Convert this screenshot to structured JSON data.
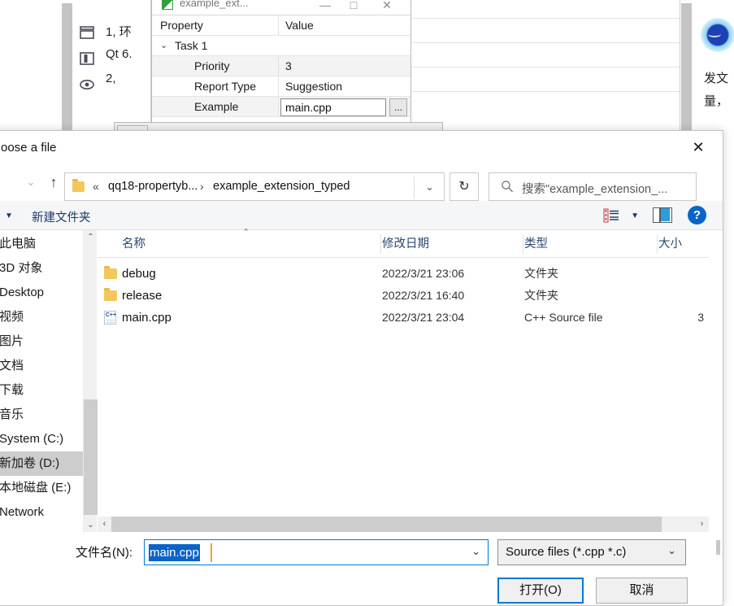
{
  "background_app": {
    "toolbar_icons": [
      "panel-top-icon",
      "panel-split-icon",
      "eye-icon"
    ],
    "code_lines": [
      "1, 环",
      "Qt 6.",
      "2,"
    ],
    "inner_window": {
      "title": "example_ext...",
      "app_icon": "app-icon",
      "minimize_label": "—",
      "maximize_label": "□",
      "close_label": "✕",
      "columns": [
        "Property",
        "Value"
      ],
      "group": {
        "label": "Task 1",
        "chevron": "⌄"
      },
      "rows": [
        {
          "property": "Priority",
          "value": "3"
        },
        {
          "property": "Report Type",
          "value": "Suggestion"
        },
        {
          "property": "Example",
          "value": "main.cpp",
          "browse_label": "..."
        }
      ]
    },
    "right_panel": {
      "avatar": "qq-avatar-icon",
      "lines": [
        "发文",
        "量，"
      ]
    }
  },
  "dialog": {
    "title": "oose a file",
    "close_label": "✕",
    "nav": {
      "back_label": "→",
      "forward_label": "⌄",
      "recent_label": "⌄",
      "up_label": "↑",
      "refresh_label": "↻"
    },
    "breadcrumb": {
      "folder_icon": "folder-icon",
      "leading_sep": "«",
      "parent": "qq18-propertyb...",
      "sep": "›",
      "current": "example_extension_typed",
      "chevron": "⌄"
    },
    "search": {
      "icon": "search-icon",
      "placeholder": "搜索\"example_extension_..."
    },
    "toolbar": {
      "caret": "▼",
      "new_folder_label": "新建文件夹",
      "view_icon": "view-list-icon",
      "view_caret": "▼",
      "preview_pane_icon": "preview-pane-icon",
      "help_label": "?"
    },
    "sidebar": {
      "items": [
        {
          "label": "此电脑",
          "icon": "this-pc-icon",
          "selected": false
        },
        {
          "label": "3D 对象",
          "icon": "3d-objects-icon",
          "selected": false
        },
        {
          "label": "Desktop",
          "icon": "desktop-icon",
          "selected": false
        },
        {
          "label": "视频",
          "icon": "videos-icon",
          "selected": false
        },
        {
          "label": "图片",
          "icon": "pictures-icon",
          "selected": false
        },
        {
          "label": "文档",
          "icon": "documents-icon",
          "selected": false
        },
        {
          "label": "下载",
          "icon": "downloads-icon",
          "selected": false
        },
        {
          "label": "音乐",
          "icon": "music-icon",
          "selected": false
        },
        {
          "label": "System (C:)",
          "icon": "drive-icon",
          "selected": false
        },
        {
          "label": "新加卷 (D:)",
          "icon": "drive-icon",
          "selected": true
        },
        {
          "label": "本地磁盘 (E:)",
          "icon": "drive-icon",
          "selected": false
        },
        {
          "label": "Network",
          "icon": "network-icon",
          "selected": false
        }
      ],
      "scroll_up": "⌃",
      "scroll_down": "⌄"
    },
    "filelist": {
      "columns": [
        "名称",
        "修改日期",
        "类型",
        "大小"
      ],
      "sort_indicator": "⌃",
      "rows": [
        {
          "icon": "folder-icon",
          "name": "debug",
          "date": "2022/3/21 23:06",
          "type": "文件夹",
          "size": ""
        },
        {
          "icon": "folder-icon",
          "name": "release",
          "date": "2022/3/21 16:40",
          "type": "文件夹",
          "size": ""
        },
        {
          "icon": "cpp-file-icon",
          "name": "main.cpp",
          "date": "2022/3/21 23:04",
          "type": "C++ Source file",
          "size": "3"
        }
      ],
      "cpp_icon_label": "C++",
      "hscroll_left": "‹",
      "hscroll_right": "›"
    },
    "bottom": {
      "filename_label": "文件名(N):",
      "filename_value": "main.cpp",
      "filename_chevron": "⌄",
      "filter_value": "Source files (*.cpp *.c)",
      "filter_chevron": "⌄",
      "open_label": "打开(O)",
      "cancel_label": "取消"
    }
  },
  "colors": {
    "accent": "#0078d7",
    "selection": "#0a64c8",
    "header_text": "#2b4a6f",
    "link": "#1c3a63",
    "folder": "#f2c75c"
  }
}
